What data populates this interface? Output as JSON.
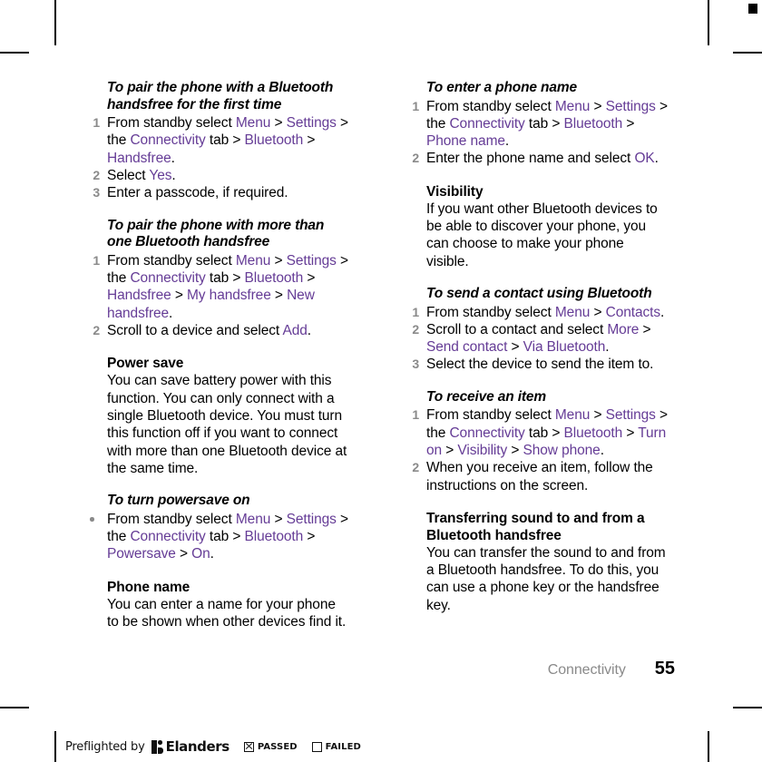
{
  "page": {
    "chapter": "Connectivity",
    "number": "55"
  },
  "left_column": {
    "section_1": {
      "heading": "To pair the phone with a Bluetooth handsfree for the first time",
      "steps": [
        {
          "num": "1",
          "parts": [
            {
              "t": "From standby select ",
              "ui": false
            },
            {
              "t": "Menu",
              "ui": true
            },
            {
              "t": " > ",
              "ui": false
            },
            {
              "t": "Settings",
              "ui": true
            },
            {
              "t": " > the ",
              "ui": false
            },
            {
              "t": "Connectivity",
              "ui": true
            },
            {
              "t": " tab > ",
              "ui": false
            },
            {
              "t": "Bluetooth",
              "ui": true
            },
            {
              "t": " > ",
              "ui": false
            },
            {
              "t": "Handsfree",
              "ui": true
            },
            {
              "t": ".",
              "ui": false
            }
          ]
        },
        {
          "num": "2",
          "parts": [
            {
              "t": "Select ",
              "ui": false
            },
            {
              "t": "Yes",
              "ui": true
            },
            {
              "t": ".",
              "ui": false
            }
          ]
        },
        {
          "num": "3",
          "parts": [
            {
              "t": "Enter a passcode, if required.",
              "ui": false
            }
          ]
        }
      ]
    },
    "section_2": {
      "heading": "To pair the phone with more than one Bluetooth handsfree",
      "steps": [
        {
          "num": "1",
          "parts": [
            {
              "t": "From standby select ",
              "ui": false
            },
            {
              "t": "Menu",
              "ui": true
            },
            {
              "t": " > ",
              "ui": false
            },
            {
              "t": "Settings",
              "ui": true
            },
            {
              "t": " > the ",
              "ui": false
            },
            {
              "t": "Connectivity",
              "ui": true
            },
            {
              "t": " tab > ",
              "ui": false
            },
            {
              "t": "Bluetooth",
              "ui": true
            },
            {
              "t": " > ",
              "ui": false
            },
            {
              "t": "Handsfree",
              "ui": true
            },
            {
              "t": " > ",
              "ui": false
            },
            {
              "t": "My handsfree",
              "ui": true
            },
            {
              "t": " > ",
              "ui": false
            },
            {
              "t": "New handsfree",
              "ui": true
            },
            {
              "t": ".",
              "ui": false
            }
          ]
        },
        {
          "num": "2",
          "parts": [
            {
              "t": "Scroll to a device and select ",
              "ui": false
            },
            {
              "t": "Add",
              "ui": true
            },
            {
              "t": ".",
              "ui": false
            }
          ]
        }
      ]
    },
    "section_3": {
      "heading": "Power save",
      "body": "You can save battery power with this function. You can only connect with a single Bluetooth device. You must turn this function off if you want to connect with more than one Bluetooth device at the same time."
    },
    "section_4": {
      "heading": "To turn powersave on",
      "steps": [
        {
          "bullet": true,
          "parts": [
            {
              "t": "From standby select ",
              "ui": false
            },
            {
              "t": "Menu",
              "ui": true
            },
            {
              "t": " > ",
              "ui": false
            },
            {
              "t": "Settings",
              "ui": true
            },
            {
              "t": " > the ",
              "ui": false
            },
            {
              "t": "Connectivity",
              "ui": true
            },
            {
              "t": " tab > ",
              "ui": false
            },
            {
              "t": "Bluetooth",
              "ui": true
            },
            {
              "t": " > ",
              "ui": false
            },
            {
              "t": "Powersave",
              "ui": true
            },
            {
              "t": " > ",
              "ui": false
            },
            {
              "t": "On",
              "ui": true
            },
            {
              "t": ".",
              "ui": false
            }
          ]
        }
      ]
    },
    "section_5": {
      "heading": "Phone name",
      "body": "You can enter a name for your phone to be shown when other devices find it."
    }
  },
  "right_column": {
    "section_1": {
      "heading": "To enter a phone name",
      "steps": [
        {
          "num": "1",
          "parts": [
            {
              "t": "From standby select ",
              "ui": false
            },
            {
              "t": "Menu",
              "ui": true
            },
            {
              "t": " > ",
              "ui": false
            },
            {
              "t": "Settings",
              "ui": true
            },
            {
              "t": " > the ",
              "ui": false
            },
            {
              "t": "Connectivity",
              "ui": true
            },
            {
              "t": " tab > ",
              "ui": false
            },
            {
              "t": "Bluetooth",
              "ui": true
            },
            {
              "t": " > ",
              "ui": false
            },
            {
              "t": "Phone name",
              "ui": true
            },
            {
              "t": ".",
              "ui": false
            }
          ]
        },
        {
          "num": "2",
          "parts": [
            {
              "t": "Enter the phone name and select ",
              "ui": false
            },
            {
              "t": "OK",
              "ui": true
            },
            {
              "t": ".",
              "ui": false
            }
          ]
        }
      ]
    },
    "section_2": {
      "heading": "Visibility",
      "body": "If you want other Bluetooth devices to be able to discover your phone, you can choose to make your phone visible."
    },
    "section_3": {
      "heading": "To send a contact using Bluetooth",
      "steps": [
        {
          "num": "1",
          "parts": [
            {
              "t": "From standby select ",
              "ui": false
            },
            {
              "t": "Menu",
              "ui": true
            },
            {
              "t": " > ",
              "ui": false
            },
            {
              "t": "Contacts",
              "ui": true
            },
            {
              "t": ".",
              "ui": false
            }
          ]
        },
        {
          "num": "2",
          "parts": [
            {
              "t": "Scroll to a contact and select ",
              "ui": false
            },
            {
              "t": "More",
              "ui": true
            },
            {
              "t": " > ",
              "ui": false
            },
            {
              "t": "Send contact",
              "ui": true
            },
            {
              "t": " > ",
              "ui": false
            },
            {
              "t": "Via Bluetooth",
              "ui": true
            },
            {
              "t": ".",
              "ui": false
            }
          ]
        },
        {
          "num": "3",
          "parts": [
            {
              "t": "Select the device to send the item to.",
              "ui": false
            }
          ]
        }
      ]
    },
    "section_4": {
      "heading": "To receive an item",
      "steps": [
        {
          "num": "1",
          "parts": [
            {
              "t": "From standby select ",
              "ui": false
            },
            {
              "t": "Menu",
              "ui": true
            },
            {
              "t": " > ",
              "ui": false
            },
            {
              "t": "Settings",
              "ui": true
            },
            {
              "t": " > the ",
              "ui": false
            },
            {
              "t": "Connectivity",
              "ui": true
            },
            {
              "t": " tab > ",
              "ui": false
            },
            {
              "t": "Bluetooth",
              "ui": true
            },
            {
              "t": " > ",
              "ui": false
            },
            {
              "t": "Turn on",
              "ui": true
            },
            {
              "t": " > ",
              "ui": false
            },
            {
              "t": "Visibility",
              "ui": true
            },
            {
              "t": " > ",
              "ui": false
            },
            {
              "t": "Show phone",
              "ui": true
            },
            {
              "t": ".",
              "ui": false
            }
          ]
        },
        {
          "num": "2",
          "parts": [
            {
              "t": "When you receive an item, follow the instructions on the screen.",
              "ui": false
            }
          ]
        }
      ]
    },
    "section_5": {
      "heading": "Transferring sound to and from a Bluetooth handsfree",
      "body": "You can transfer the sound to and from a Bluetooth handsfree. To do this, you can use a phone key or the handsfree key."
    }
  },
  "preflight": {
    "prefix": "Preflighted by",
    "brand": "Elanders",
    "passed_label": "PASSED",
    "failed_label": "FAILED",
    "passed_checked": true,
    "failed_checked": false
  },
  "colors": {
    "ui_reference": "#653c96",
    "step_number": "#8a8a8a",
    "chapter": "#8a8a8a",
    "text": "#000000"
  }
}
